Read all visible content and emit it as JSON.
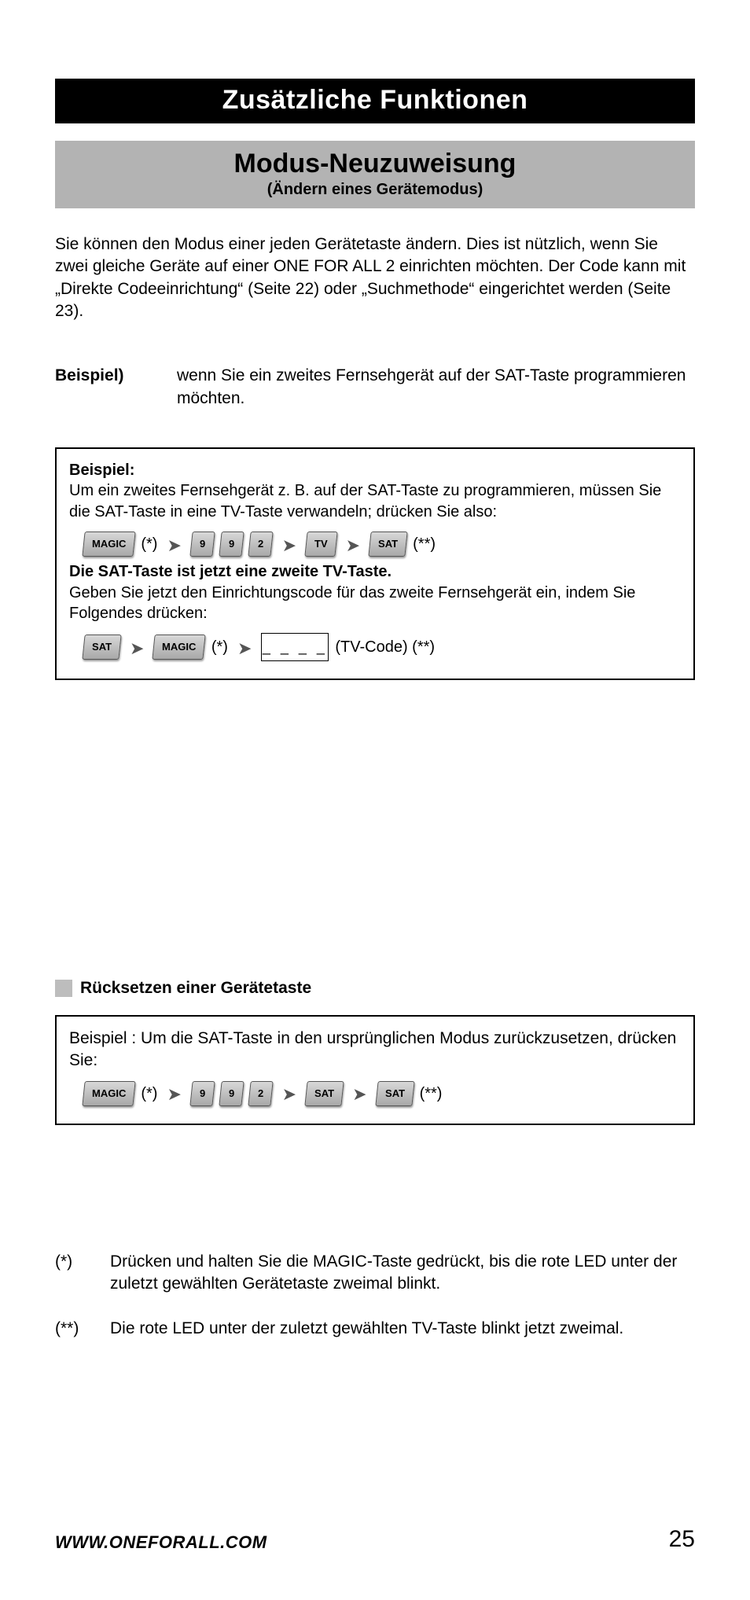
{
  "header": {
    "black_bar": "Zusätzliche Funktionen",
    "grey_title": "Modus-Neuzuweisung",
    "grey_subtitle": "(Ändern eines Gerätemodus)"
  },
  "intro": "Sie können den Modus einer jeden Gerätetaste ändern. Dies ist nützlich, wenn Sie zwei gleiche Geräte auf einer ONE FOR ALL 2 einrichten möchten. Der Code kann mit „Direkte Codeeinrichtung“  (Seite 22) oder „Suchmethode“ eingerichtet werden (Seite 23).",
  "example_inline": {
    "label": "Beispiel)",
    "text": "wenn Sie ein zweites Fernsehgerät auf der SAT-Taste programmieren möchten."
  },
  "box1": {
    "title": "Beispiel:",
    "line1": "Um ein zweites Fernsehgerät z. B. auf der SAT-Taste zu programmieren, müssen Sie die SAT-Taste in eine TV-Taste verwandeln; drücken Sie also:",
    "keys1": [
      "MAGIC",
      "9",
      "9",
      "2",
      "TV",
      "SAT"
    ],
    "star1": "(*)",
    "star2": "(**)",
    "bold_line": "Die SAT-Taste ist jetzt eine zweite TV-Taste.",
    "line2": "Geben Sie jetzt den Einrichtungscode für das zweite Fernsehgerät ein, indem Sie Folgendes drücken:",
    "keys2": [
      "SAT",
      "MAGIC"
    ],
    "code_placeholder": "_ _ _ _",
    "code_label": "(TV-Code) (**)"
  },
  "section2": {
    "heading": "Rücksetzen einer Gerätetaste"
  },
  "box2": {
    "line1": "Beispiel : Um die SAT-Taste in den ursprünglichen Modus zurückzusetzen, drücken Sie:",
    "keys": [
      "MAGIC",
      "9",
      "9",
      "2",
      "SAT",
      "SAT"
    ],
    "star1": "(*)",
    "star2": "(**)"
  },
  "footnotes": {
    "f1_mark": "(*)",
    "f1_text": "Drücken und halten Sie die MAGIC-Taste gedrückt, bis die rote LED unter der zuletzt gewählten Gerätetaste zweimal blinkt.",
    "f2_mark": "(**)",
    "f2_text": "Die rote LED unter der zuletzt gewählten TV-Taste blinkt jetzt zweimal."
  },
  "footer": {
    "url": "WWW.ONEFORALL.COM",
    "page": "25"
  }
}
